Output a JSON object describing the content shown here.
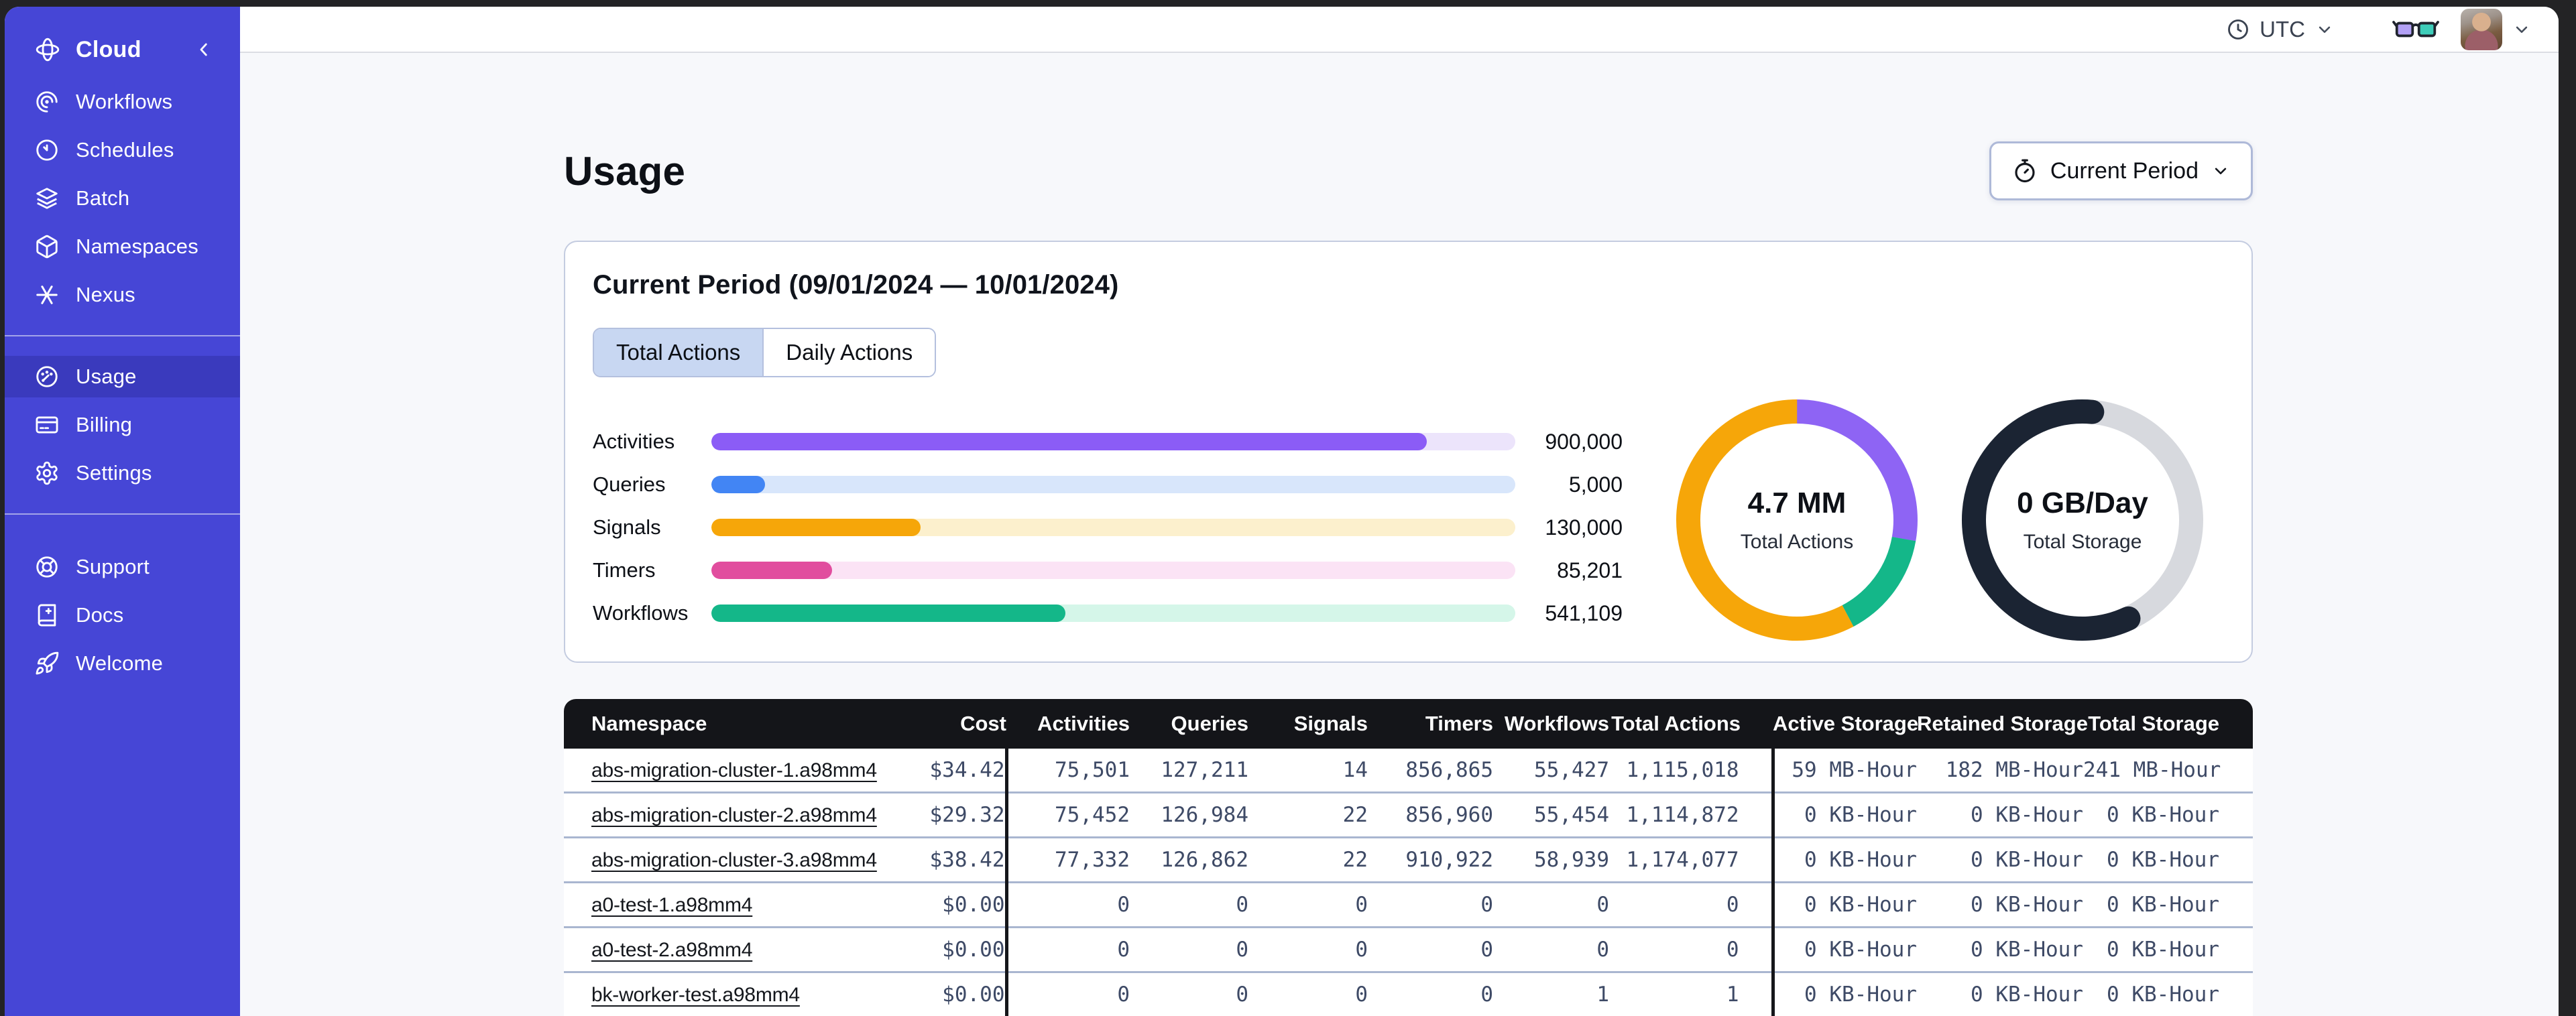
{
  "sidebar": {
    "brand": {
      "label": "Cloud",
      "icon": "temporal-logo"
    },
    "nav_main": [
      {
        "label": "Workflows",
        "icon": "workflows"
      },
      {
        "label": "Schedules",
        "icon": "schedules"
      },
      {
        "label": "Batch",
        "icon": "batch"
      },
      {
        "label": "Namespaces",
        "icon": "namespaces"
      },
      {
        "label": "Nexus",
        "icon": "nexus"
      }
    ],
    "nav_account": [
      {
        "label": "Usage",
        "icon": "usage",
        "active": true
      },
      {
        "label": "Billing",
        "icon": "billing"
      },
      {
        "label": "Settings",
        "icon": "settings"
      }
    ],
    "nav_footer": [
      {
        "label": "Support",
        "icon": "support"
      },
      {
        "label": "Docs",
        "icon": "docs"
      },
      {
        "label": "Welcome",
        "icon": "welcome"
      }
    ]
  },
  "topbar": {
    "timezone": "UTC"
  },
  "page": {
    "title": "Usage",
    "period_button": {
      "label": "Current Period",
      "icon": "stopwatch"
    }
  },
  "usage_card": {
    "title": "Current Period (09/01/2024 — 10/01/2024)",
    "tabs": [
      {
        "label": "Total Actions",
        "selected": true
      },
      {
        "label": "Daily Actions",
        "selected": false
      }
    ],
    "chart_data": {
      "type": "bar",
      "categories": [
        "Activities",
        "Queries",
        "Signals",
        "Timers",
        "Workflows"
      ],
      "values": [
        900000,
        5000,
        130000,
        85201,
        541109
      ],
      "display_values": [
        "900,000",
        "5,000",
        "130,000",
        "85,201",
        "541,109"
      ],
      "fill_pct": [
        89,
        6.7,
        26,
        15,
        44
      ],
      "bar_colors": [
        "#8b5cf6",
        "#4285f4",
        "#f6a609",
        "#e14d9e",
        "#14b789"
      ],
      "track_colors": [
        "#ece4fb",
        "#d8e6fb",
        "#fcf0cd",
        "#fbe3f5",
        "#d5f6e9"
      ]
    },
    "donuts": [
      {
        "value": "4.7 MM",
        "label": "Total Actions",
        "cap": "butt",
        "base_color": null,
        "segments": [
          {
            "name": "activities",
            "color": "#8e64f4",
            "start": 0,
            "deg": 100
          },
          {
            "name": "workflows",
            "color": "#14b789",
            "start": 100,
            "deg": 52
          },
          {
            "name": "signals",
            "color": "#f6a609",
            "start": 152,
            "deg": 208
          }
        ]
      },
      {
        "value": "0 GB/Day",
        "label": "Total Storage",
        "cap": "round",
        "base_color": "#d7d9de",
        "segments": [
          {
            "name": "storage",
            "color": "#1b2433",
            "start": 155,
            "deg": 210
          }
        ]
      }
    ]
  },
  "table": {
    "columns": [
      "Namespace",
      "Cost",
      "Activities",
      "Queries",
      "Signals",
      "Timers",
      "Workflows",
      "Total Actions",
      "Active Storage",
      "Retained Storage",
      "Total Storage"
    ],
    "rows": [
      {
        "namespace": "abs-migration-cluster-1.a98mm4",
        "values": [
          "$34.42",
          "75,501",
          "127,211",
          "14",
          "856,865",
          "55,427",
          "1,115,018",
          "59 MB-Hour",
          "182 MB-Hour",
          "241 MB-Hour"
        ]
      },
      {
        "namespace": "abs-migration-cluster-2.a98mm4",
        "values": [
          "$29.32",
          "75,452",
          "126,984",
          "22",
          "856,960",
          "55,454",
          "1,114,872",
          "0 KB-Hour",
          "0 KB-Hour",
          "0 KB-Hour"
        ]
      },
      {
        "namespace": "abs-migration-cluster-3.a98mm4",
        "values": [
          "$38.42",
          "77,332",
          "126,862",
          "22",
          "910,922",
          "58,939",
          "1,174,077",
          "0 KB-Hour",
          "0 KB-Hour",
          "0 KB-Hour"
        ]
      },
      {
        "namespace": "a0-test-1.a98mm4",
        "values": [
          "$0.00",
          "0",
          "0",
          "0",
          "0",
          "0",
          "0",
          "0 KB-Hour",
          "0 KB-Hour",
          "0 KB-Hour"
        ]
      },
      {
        "namespace": "a0-test-2.a98mm4",
        "values": [
          "$0.00",
          "0",
          "0",
          "0",
          "0",
          "0",
          "0",
          "0 KB-Hour",
          "0 KB-Hour",
          "0 KB-Hour"
        ]
      },
      {
        "namespace": "bk-worker-test.a98mm4",
        "values": [
          "$0.00",
          "0",
          "0",
          "0",
          "0",
          "1",
          "1",
          "0 KB-Hour",
          "0 KB-Hour",
          "0 KB-Hour"
        ]
      }
    ]
  }
}
